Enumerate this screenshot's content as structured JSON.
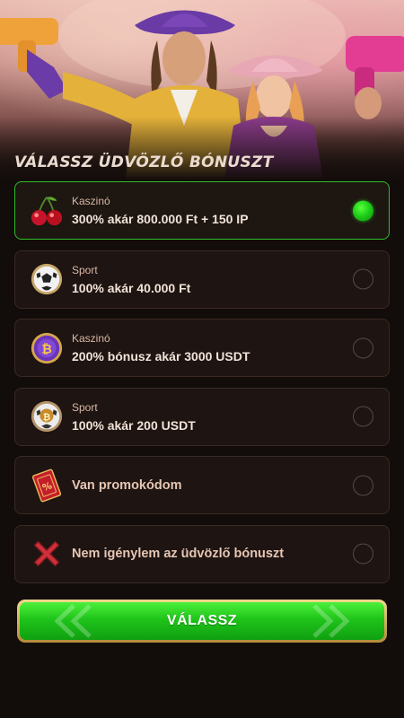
{
  "header": {
    "title": "VÁLASSZ ÜDVÖZLŐ BÓNUSZT"
  },
  "options": [
    {
      "category": "Kaszinó",
      "text": "300% akár 800.000 Ft + 150 IP",
      "icon": "cherry-icon",
      "selected": true
    },
    {
      "category": "Sport",
      "text": "100% akár 40.000 Ft",
      "icon": "soccer-ball-icon",
      "selected": false
    },
    {
      "category": "Kaszinó",
      "text": "200% bónusz akár 3000 USDT",
      "icon": "bitcoin-coin-icon",
      "selected": false
    },
    {
      "category": "Sport",
      "text": "100% akár 200 USDT",
      "icon": "bitcoin-soccer-ball-icon",
      "selected": false
    },
    {
      "category": "",
      "text": "Van promokódom",
      "icon": "promo-ticket-icon",
      "selected": false
    },
    {
      "category": "",
      "text": "Nem igénylem az üdvözlő bónuszt",
      "icon": "red-x-icon",
      "selected": false
    }
  ],
  "cta": {
    "label": "VÁLASSZ"
  },
  "colors": {
    "selected_border": "#2fbf2a",
    "radio_on": "#1fd01a",
    "cta_green": "#1fc41a",
    "cta_gold": "#d8b562"
  }
}
